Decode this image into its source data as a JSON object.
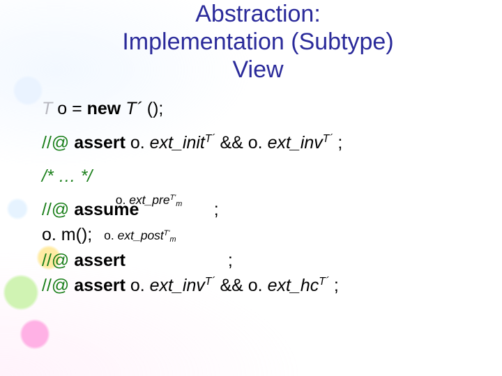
{
  "title": {
    "line1": "Abstraction:",
    "line2": "Implementation (Subtype)",
    "line3": "View"
  },
  "typeVar": "T",
  "typePrime": "T´",
  "typePrimeAlt": "T'",
  "code": {
    "declPrefix": " o = ",
    "newKw": "new",
    "declSuffix": "();",
    "cmtPrefix": "//@",
    "assertKw": "assert",
    "assumeKw": "assume",
    "oDot": " o. ",
    "extInit": "ext_init",
    "extInv": "ext_inv",
    "extPre": "ext_pre",
    "extPost": "ext_post",
    "extHc": "ext_hc",
    "and": " && ",
    "semi": " ;",
    "mSub": "m",
    "ellipsis": "/* … */",
    "call": "o. m();"
  }
}
